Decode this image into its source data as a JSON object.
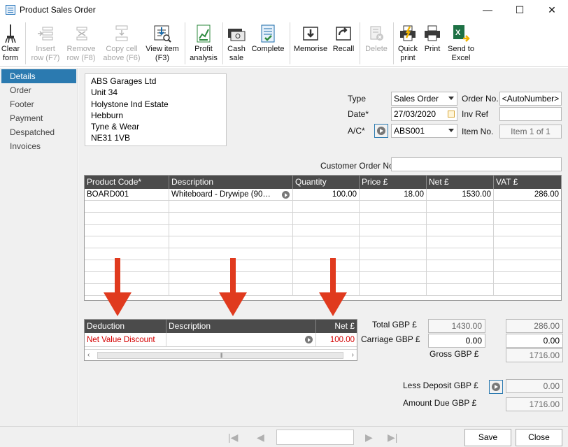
{
  "window": {
    "title": "Product Sales Order",
    "controls": [
      "—",
      "☐",
      "✕"
    ]
  },
  "toolbar": {
    "buttons": [
      {
        "label1": "Clear",
        "label2": "form",
        "icon": "broom-icon",
        "disabled": false
      },
      {
        "label1": "Insert",
        "label2": "row (F7)",
        "icon": "insert-row-icon",
        "disabled": true
      },
      {
        "label1": "Remove",
        "label2": "row (F8)",
        "icon": "remove-row-icon",
        "disabled": true
      },
      {
        "label1": "Copy cell",
        "label2": "above (F6)",
        "icon": "copy-cell-icon",
        "disabled": true
      },
      {
        "label1": "View item",
        "label2": "(F3)",
        "icon": "view-item-icon",
        "disabled": false
      },
      {
        "label1": "Profit",
        "label2": "analysis",
        "icon": "chart-icon",
        "disabled": false
      },
      {
        "label1": "Cash",
        "label2": "sale",
        "icon": "cash-icon",
        "disabled": false
      },
      {
        "label1": "Complete",
        "label2": "",
        "icon": "complete-icon",
        "disabled": false
      },
      {
        "label1": "Memorise",
        "label2": "",
        "icon": "memorise-icon",
        "disabled": false
      },
      {
        "label1": "Recall",
        "label2": "",
        "icon": "recall-icon",
        "disabled": false
      },
      {
        "label1": "Delete",
        "label2": "",
        "icon": "delete-icon",
        "disabled": true
      },
      {
        "label1": "Quick",
        "label2": "print",
        "icon": "quick-print-icon",
        "disabled": false
      },
      {
        "label1": "Print",
        "label2": "",
        "icon": "printer-icon",
        "disabled": false
      },
      {
        "label1": "Send to",
        "label2": "Excel",
        "icon": "excel-icon",
        "disabled": false
      }
    ]
  },
  "nav": {
    "items": [
      "Details",
      "Order",
      "Footer",
      "Payment",
      "Despatched",
      "Invoices"
    ],
    "active": "Details"
  },
  "address": {
    "lines": [
      "ABS Garages Ltd",
      "Unit 34",
      "Holystone Ind Estate",
      "Hebburn",
      "Tyne & Wear",
      "NE31 1VB"
    ]
  },
  "fields": {
    "type_label": "Type",
    "type_value": "Sales Order",
    "date_label": "Date*",
    "date_value": "27/03/2020",
    "ac_label": "A/C*",
    "ac_value": "ABS001",
    "order_no_label": "Order No.",
    "order_no_value": "<AutoNumber>",
    "inv_ref_label": "Inv Ref",
    "inv_ref_value": "",
    "item_no_label": "Item No.",
    "item_no_value": "Item 1 of 1",
    "customer_order_label": "Customer Order No.",
    "customer_order_value": ""
  },
  "items_grid": {
    "columns": [
      "Product Code*",
      "Description",
      "Quantity",
      "Price £",
      "Net £",
      "VAT £"
    ],
    "rows": [
      {
        "product_code": "BOARD001",
        "description": "Whiteboard - Drywipe (90…",
        "quantity": "100.00",
        "price": "18.00",
        "net": "1530.00",
        "vat": "286.00"
      }
    ],
    "empty_rows": 8
  },
  "deduction_grid": {
    "columns": [
      "Deduction",
      "Description",
      "Net £"
    ],
    "rows": [
      {
        "deduction": "Net Value Discount",
        "description": "",
        "net": "100.00"
      }
    ]
  },
  "totals": {
    "total_label": "Total GBP £",
    "total_net": "1430.00",
    "total_vat": "286.00",
    "carriage_label": "Carriage GBP £",
    "carriage_net": "0.00",
    "carriage_vat": "0.00",
    "gross_label": "Gross GBP £",
    "gross_value": "1716.00",
    "deposit_label": "Less Deposit GBP £",
    "deposit_value": "0.00",
    "amount_due_label": "Amount Due GBP £",
    "amount_due_value": "1716.00"
  },
  "footer": {
    "save_label": "Save",
    "close_label": "Close",
    "record_value": ""
  },
  "colors": {
    "header_dark": "#4b4b4b",
    "nav_active": "#2b7ab0",
    "annotation_red": "#e03a1e",
    "discount_red": "#d40000"
  }
}
